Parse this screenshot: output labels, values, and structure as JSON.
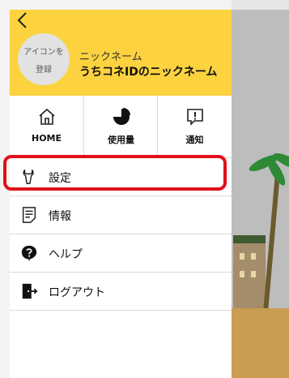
{
  "header": {
    "avatar_text_line1": "アイコンを",
    "avatar_text_line2": "登録",
    "nickname_label": "ニックネーム",
    "nickname_value": "うちコネIDのニックネーム"
  },
  "quick_actions": [
    {
      "label": "HOME",
      "icon": "home-icon"
    },
    {
      "label": "使用量",
      "icon": "pie-chart-icon"
    },
    {
      "label": "通知",
      "icon": "notification-icon"
    }
  ],
  "menu": [
    {
      "label": "設定",
      "icon": "wrench-icon"
    },
    {
      "label": "情報",
      "icon": "document-icon"
    },
    {
      "label": "ヘルプ",
      "icon": "help-icon"
    },
    {
      "label": "ログアウト",
      "icon": "logout-icon"
    }
  ],
  "colors": {
    "header_bg": "#fcd23f",
    "highlight": "#e0101a"
  }
}
